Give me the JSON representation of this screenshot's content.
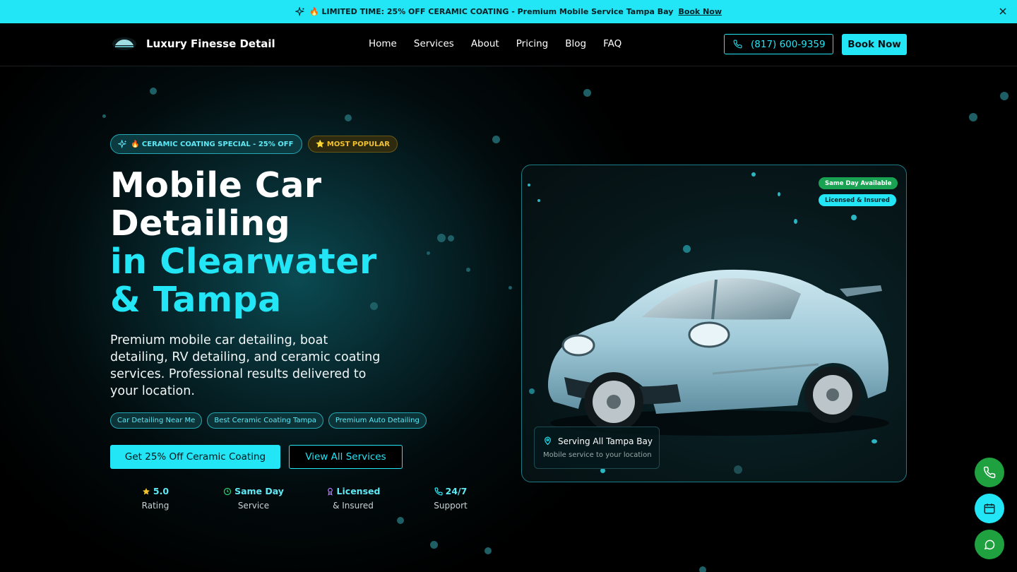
{
  "promo": {
    "text": "🔥 LIMITED TIME: 25% OFF CERAMIC COATING - Premium Mobile Service Tampa Bay",
    "link": "Book Now"
  },
  "header": {
    "brand": "Luxury Finesse Detail",
    "nav": [
      "Home",
      "Services",
      "About",
      "Pricing",
      "Blog",
      "FAQ"
    ],
    "phone": "(817) 600-9359",
    "book": "Book Now"
  },
  "hero": {
    "badge_special": "🔥 CERAMIC COATING SPECIAL - 25% OFF",
    "badge_popular": "⭐ MOST POPULAR",
    "title_line1": "Mobile Car",
    "title_line2": "Detailing",
    "title_line3": "in Clearwater",
    "title_line4": "& Tampa",
    "description": "Premium mobile car detailing, boat detailing, RV detailing, and ceramic coating services. Professional results delivered to your location.",
    "tags": [
      "Car Detailing Near Me",
      "Best Ceramic Coating Tampa",
      "Premium Auto Detailing"
    ],
    "cta_primary": "Get 25% Off Ceramic Coating",
    "cta_secondary": "View All Services",
    "stats": [
      {
        "value": "5.0",
        "label": "Rating",
        "icon": "star-icon",
        "color": "#f2c12e"
      },
      {
        "value": "Same Day",
        "label": "Service",
        "icon": "clock-icon",
        "color": "#2ecc71"
      },
      {
        "value": "Licensed",
        "label": "& Insured",
        "icon": "award-icon",
        "color": "#b57cff"
      },
      {
        "value": "24/7",
        "label": "Support",
        "icon": "phone-icon",
        "color": "#22e5f5"
      }
    ]
  },
  "card": {
    "pill_same_day": "Same Day Available",
    "pill_licensed": "Licensed & Insured",
    "location_title": "Serving All Tampa Bay",
    "location_sub": "Mobile service to your location"
  },
  "colors": {
    "accent": "#22e5f5",
    "whatsapp": "#25b84a",
    "call": "#1fa13f"
  }
}
